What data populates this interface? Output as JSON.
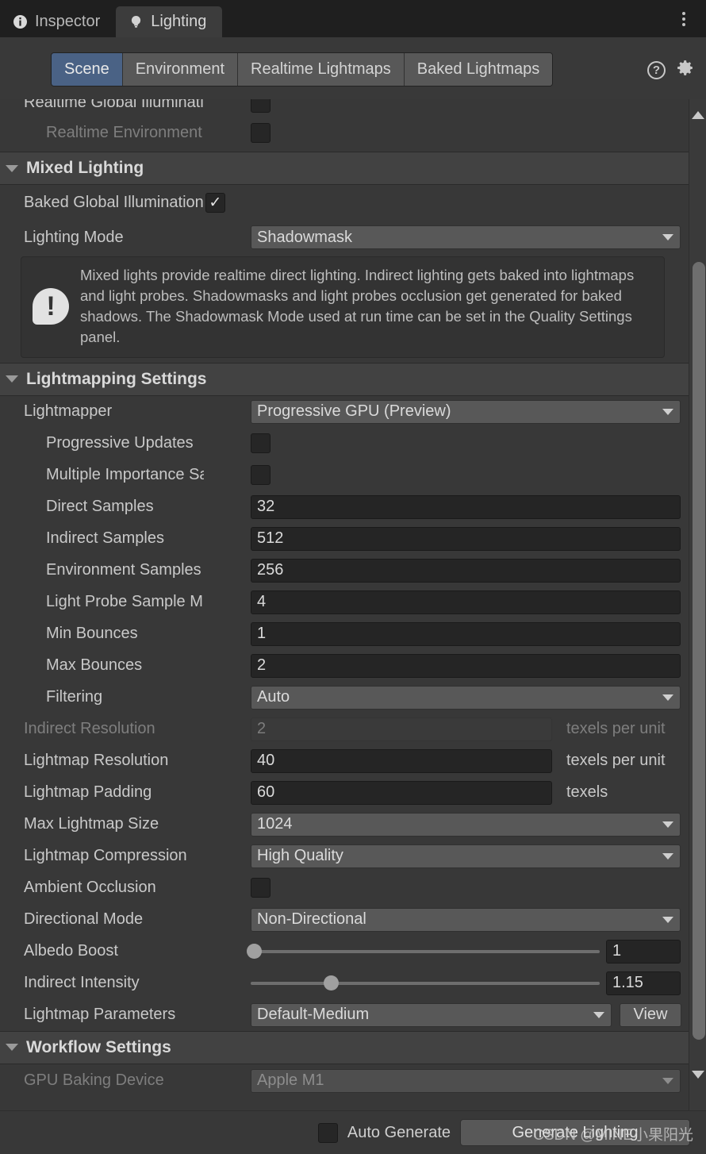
{
  "window": {
    "tabs": [
      {
        "label": "Inspector",
        "icon": "info-circle-icon",
        "active": false
      },
      {
        "label": "Lighting",
        "icon": "lightbulb-icon",
        "active": true
      }
    ],
    "menu_icon": "kebab-menu-icon"
  },
  "toolbar": {
    "modes": [
      {
        "label": "Scene",
        "active": true
      },
      {
        "label": "Environment",
        "active": false
      },
      {
        "label": "Realtime Lightmaps",
        "active": false
      },
      {
        "label": "Baked Lightmaps",
        "active": false
      }
    ],
    "help_icon": "help-icon",
    "help_glyph": "?",
    "settings_icon": "gear-icon"
  },
  "clipped_top": {
    "realtime_gi_label": "Realtime Global Illuminati",
    "realtime_env_label": "Realtime Environment"
  },
  "mixed_lighting": {
    "title": "Mixed Lighting",
    "baked_gi": {
      "label": "Baked Global Illumination",
      "checked": true,
      "check_glyph": "✓"
    },
    "lighting_mode": {
      "label": "Lighting Mode",
      "value": "Shadowmask"
    },
    "info": "Mixed lights provide realtime direct lighting. Indirect lighting gets baked into lightmaps and light probes. Shadowmasks and light probes occlusion get generated for baked shadows. The Shadowmask Mode used at run time can be set in the Quality Settings panel."
  },
  "lightmapping": {
    "title": "Lightmapping Settings",
    "rows": [
      {
        "label": "Lightmapper",
        "type": "dropdown",
        "value": "Progressive GPU (Preview)",
        "indent": 0
      },
      {
        "label": "Progressive Updates",
        "type": "checkbox",
        "checked": false,
        "indent": 1
      },
      {
        "label": "Multiple Importance Sa",
        "type": "checkbox",
        "checked": false,
        "indent": 1
      },
      {
        "label": "Direct Samples",
        "type": "field",
        "value": "32",
        "indent": 1
      },
      {
        "label": "Indirect Samples",
        "type": "field",
        "value": "512",
        "indent": 1
      },
      {
        "label": "Environment Samples",
        "type": "field",
        "value": "256",
        "indent": 1
      },
      {
        "label": "Light Probe Sample Mu",
        "type": "field",
        "value": "4",
        "indent": 1
      },
      {
        "label": "Min Bounces",
        "type": "field",
        "value": "1",
        "indent": 1
      },
      {
        "label": "Max Bounces",
        "type": "field",
        "value": "2",
        "indent": 1
      },
      {
        "label": "Filtering",
        "type": "dropdown",
        "value": "Auto",
        "indent": 1
      },
      {
        "label": "Indirect Resolution",
        "type": "field-unit",
        "value": "2",
        "unit": "texels per unit",
        "disabled": true,
        "indent": 0
      },
      {
        "label": "Lightmap Resolution",
        "type": "field-unit",
        "value": "40",
        "unit": "texels per unit",
        "indent": 0
      },
      {
        "label": "Lightmap Padding",
        "type": "field-unit",
        "value": "60",
        "unit": "texels",
        "indent": 0
      },
      {
        "label": "Max Lightmap Size",
        "type": "dropdown",
        "value": "1024",
        "indent": 0
      },
      {
        "label": "Lightmap Compression",
        "type": "dropdown",
        "value": "High Quality",
        "indent": 0
      },
      {
        "label": "Ambient Occlusion",
        "type": "checkbox",
        "checked": false,
        "indent": 0
      },
      {
        "label": "Directional Mode",
        "type": "dropdown",
        "value": "Non-Directional",
        "indent": 0
      },
      {
        "label": "Albedo Boost",
        "type": "slider",
        "value": "1",
        "fill": 1,
        "indent": 0
      },
      {
        "label": "Indirect Intensity",
        "type": "slider",
        "value": "1.15",
        "fill": 23,
        "indent": 0
      },
      {
        "label": "Lightmap Parameters",
        "type": "dropdown-button",
        "value": "Default-Medium",
        "button": "View",
        "indent": 0
      }
    ]
  },
  "workflow": {
    "title": "Workflow Settings",
    "gpu_device": {
      "label": "GPU Baking Device",
      "value": "Apple M1",
      "disabled": true
    }
  },
  "footer": {
    "auto_generate_label": "Auto Generate",
    "auto_generate_checked": false,
    "generate_button": "Generate Lighting"
  },
  "watermark": "CSDN @MINE小果阳光"
}
